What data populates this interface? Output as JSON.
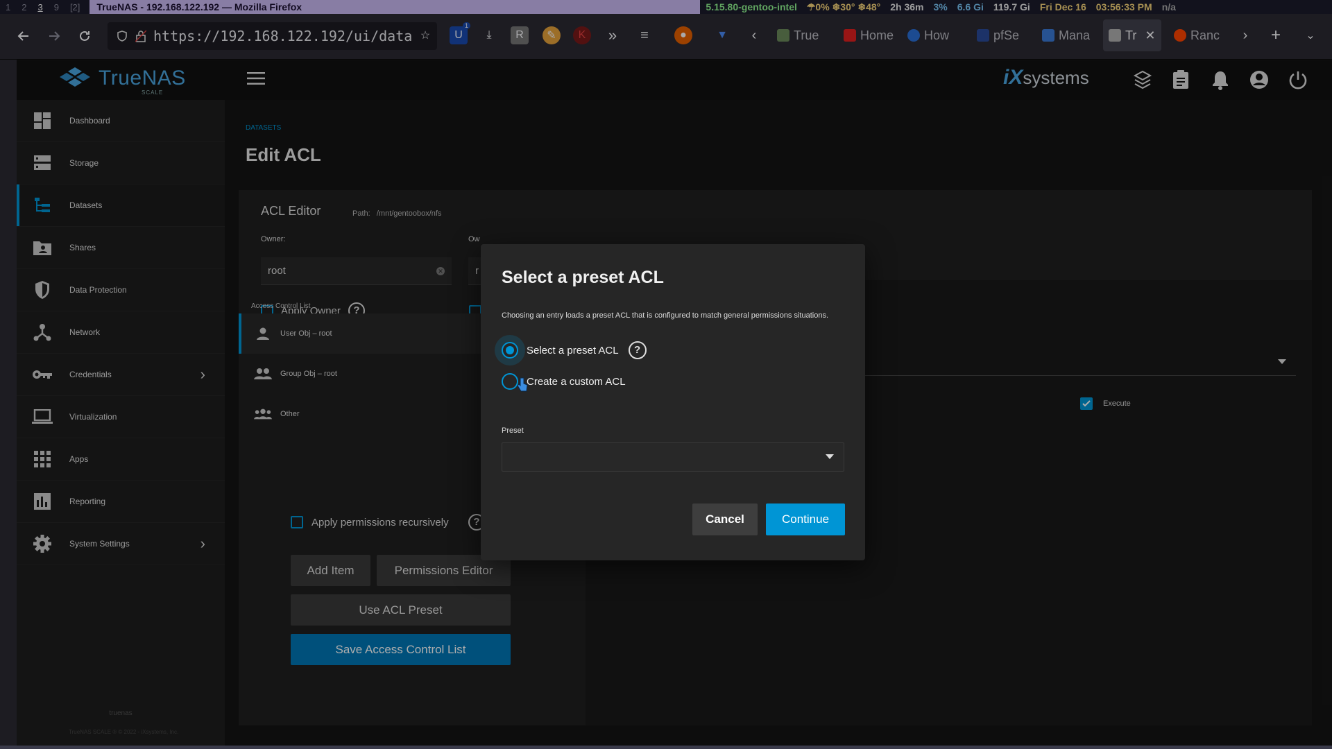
{
  "sysbar": {
    "workspaces": [
      "1",
      "2",
      "3",
      "9",
      "[2]"
    ],
    "current_workspace": "3",
    "window_title": "TrueNAS - 192.168.122.192 — Mozilla Firefox",
    "kernel": "5.15.80-gentoo-intel",
    "weather": "☂0% ❄30° ❄48°",
    "uptime": "2h 36m",
    "cpu": "3%",
    "mem": "6.6 Gi",
    "disk": "119.7 Gi",
    "date": "Fri Dec 16",
    "time": "03:56:33 PM",
    "battery": "n/a"
  },
  "browser": {
    "url": "https://192.168.122.192/ui/data",
    "ext_badge": "1",
    "tabs": [
      {
        "label": "True",
        "color": "#6a8a5a"
      },
      {
        "label": "Home",
        "color": "#e02020"
      },
      {
        "label": "How",
        "color": "#2a6fd6"
      },
      {
        "label": "pfSe",
        "color": "#2a4a9a"
      },
      {
        "label": "Mana",
        "color": "#3a7ad6"
      },
      {
        "label": "Tr",
        "color": "#b0b0b0"
      },
      {
        "label": "Ranc",
        "color": "#ff4500"
      }
    ],
    "active_tab_index": 5
  },
  "app": {
    "logo_text": "TrueNAS",
    "logo_sub": "SCALE",
    "vendor": "iXsystems"
  },
  "sidebar": {
    "items": [
      {
        "label": "Dashboard",
        "icon": "dashboard-icon"
      },
      {
        "label": "Storage",
        "icon": "storage-icon"
      },
      {
        "label": "Datasets",
        "icon": "datasets-icon"
      },
      {
        "label": "Shares",
        "icon": "shares-icon"
      },
      {
        "label": "Data Protection",
        "icon": "shield-icon"
      },
      {
        "label": "Network",
        "icon": "network-icon"
      },
      {
        "label": "Credentials",
        "icon": "key-icon"
      },
      {
        "label": "Virtualization",
        "icon": "laptop-icon"
      },
      {
        "label": "Apps",
        "icon": "apps-grid-icon"
      },
      {
        "label": "Reporting",
        "icon": "bar-chart-icon"
      },
      {
        "label": "System Settings",
        "icon": "gear-icon"
      }
    ],
    "active": "Datasets",
    "footer_host": "truenas",
    "footer_copy": "TrueNAS SCALE ® © 2022 - iXsystems, Inc."
  },
  "page": {
    "breadcrumb": "DATASETS",
    "title": "Edit ACL",
    "acl_editor_title": "ACL Editor",
    "path_label": "Path:",
    "path_value": "/mnt/gentoobox/nfs",
    "owner_label": "Owner:",
    "owner_value": "root",
    "owner_group_label": "Ow",
    "owner_group_value": "r",
    "apply_owner_label": "Apply Owner",
    "acl_list_header": "Access Control List",
    "acl_items": [
      "User Obj – root",
      "Group Obj – root",
      "Other"
    ],
    "apply_recursive_label": "Apply permissions recursively",
    "execute_label": "Execute",
    "buttons": {
      "add_item": "Add Item",
      "permissions_editor": "Permissions Editor",
      "use_acl_preset": "Use ACL Preset",
      "save_acl": "Save Access Control List"
    }
  },
  "modal": {
    "title": "Select a preset ACL",
    "description": "Choosing an entry loads a preset ACL that is configured to match general permissions situations.",
    "option_preset": "Select a preset ACL",
    "option_custom": "Create a custom ACL",
    "selected_option": "preset",
    "preset_label": "Preset",
    "preset_value": "",
    "cancel": "Cancel",
    "continue": "Continue",
    "accent": "#0095d5"
  }
}
